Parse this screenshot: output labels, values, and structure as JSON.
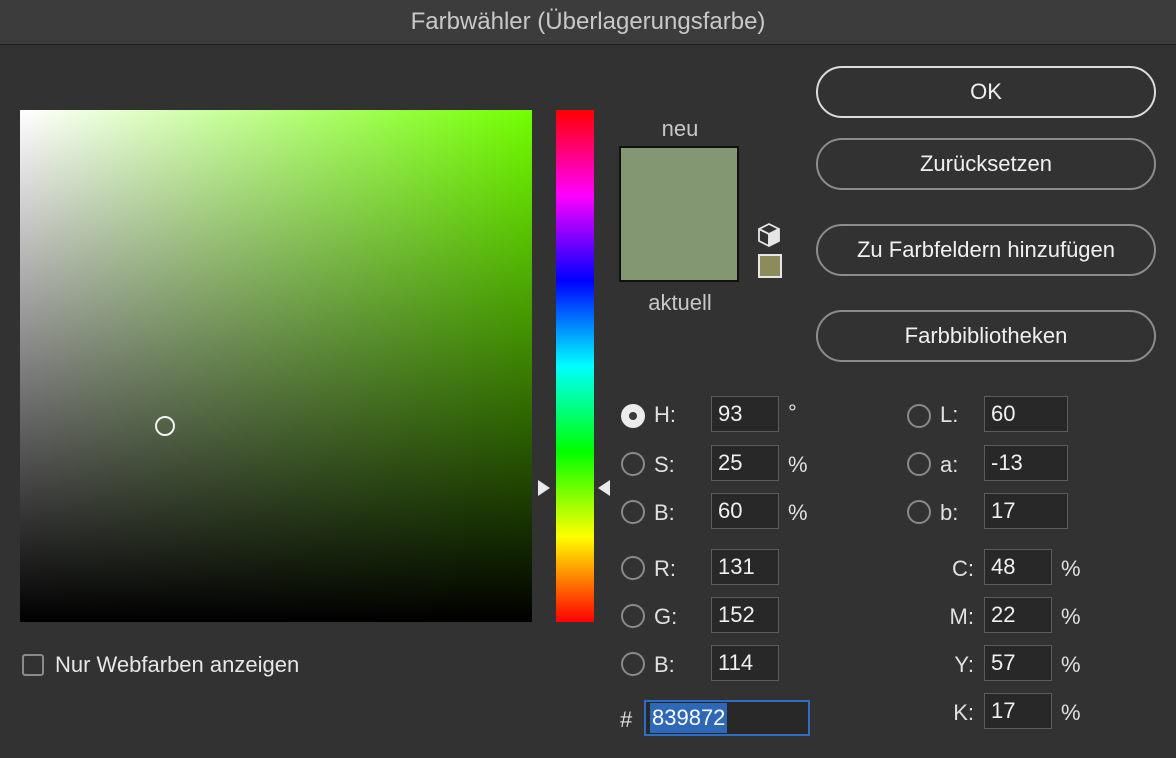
{
  "window": {
    "title": "Farbwähler (Überlagerungsfarbe)"
  },
  "colors": {
    "new_color": "#839872",
    "current_color": "#8b8b5c",
    "hue_pure": "#72ff00",
    "accent": "#2e68b8"
  },
  "preview": {
    "new_label": "neu",
    "current_label": "aktuell",
    "icon": "cube-icon"
  },
  "buttons": {
    "ok": "OK",
    "reset": "Zurücksetzen",
    "add_to_swatches": "Zu Farbfeldern hinzufügen",
    "color_libraries": "Farbbibliotheken"
  },
  "hsb": {
    "h": {
      "label": "H:",
      "value": "93",
      "unit": "°",
      "selected": true
    },
    "s": {
      "label": "S:",
      "value": "25",
      "unit": "%"
    },
    "b": {
      "label": "B:",
      "value": "60",
      "unit": "%"
    }
  },
  "rgb": {
    "r": {
      "label": "R:",
      "value": "131"
    },
    "g": {
      "label": "G:",
      "value": "152"
    },
    "b": {
      "label": "B:",
      "value": "114"
    }
  },
  "lab": {
    "l": {
      "label": "L:",
      "value": "60"
    },
    "a": {
      "label": "a:",
      "value": "-13"
    },
    "b": {
      "label": "b:",
      "value": "17"
    }
  },
  "cmyk": {
    "c": {
      "label": "C:",
      "value": "48",
      "unit": "%"
    },
    "m": {
      "label": "M:",
      "value": "22",
      "unit": "%"
    },
    "y": {
      "label": "Y:",
      "value": "57",
      "unit": "%"
    },
    "k": {
      "label": "K:",
      "value": "17",
      "unit": "%"
    }
  },
  "hex": {
    "label": "#",
    "value": "839872"
  },
  "web_only": {
    "label": "Nur Webfarben anzeigen",
    "checked": false
  }
}
